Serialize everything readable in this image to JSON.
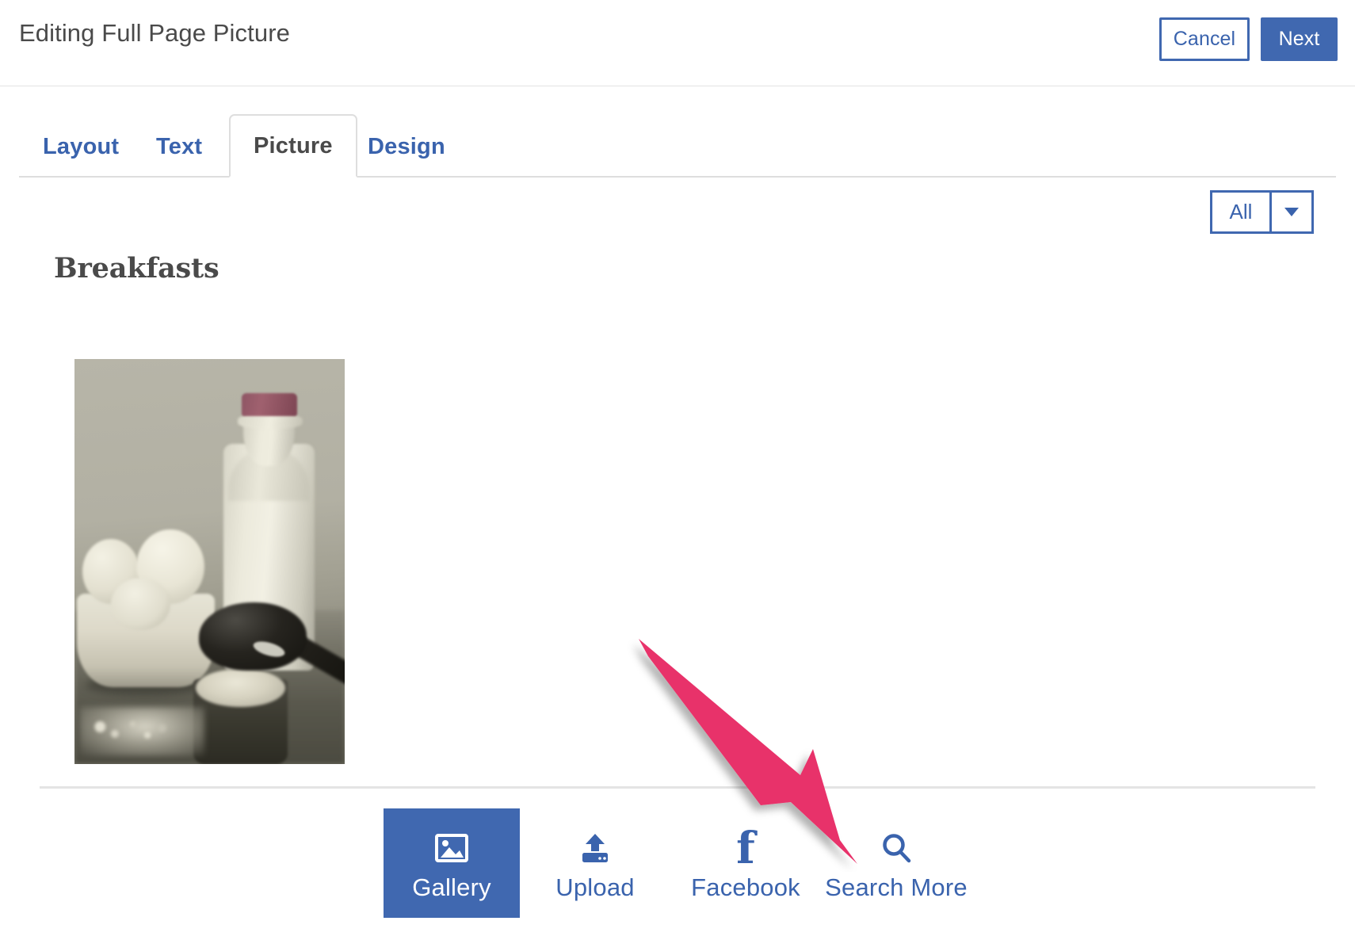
{
  "header": {
    "title": "Editing Full Page Picture",
    "cancel_label": "Cancel",
    "next_label": "Next"
  },
  "tabs": [
    {
      "label": "Layout",
      "active": false
    },
    {
      "label": "Text",
      "active": false
    },
    {
      "label": "Picture",
      "active": true
    },
    {
      "label": "Design",
      "active": false
    }
  ],
  "filter": {
    "selected": "All",
    "caret_icon": "chevron-down-icon"
  },
  "gallery": {
    "section_title": "Breakfasts",
    "items": [
      {
        "alt": "eggs in a bowl, milk bottle and flour in a measuring cup"
      }
    ]
  },
  "footer": {
    "items": [
      {
        "label": "Gallery",
        "icon": "image-icon",
        "active": true
      },
      {
        "label": "Upload",
        "icon": "upload-icon",
        "active": false
      },
      {
        "label": "Facebook",
        "icon": "facebook-icon",
        "active": false
      },
      {
        "label": "Search More",
        "icon": "search-icon",
        "active": false
      }
    ]
  },
  "annotation": {
    "type": "arrow",
    "color": "#e8336a",
    "points_to": "Search More"
  },
  "colors": {
    "accent_blue": "#4068b0",
    "link_blue": "#3a63ad",
    "text_dark": "#4a4a4a",
    "divider": "#e4e4e4",
    "annotation_pink": "#e8336a"
  }
}
